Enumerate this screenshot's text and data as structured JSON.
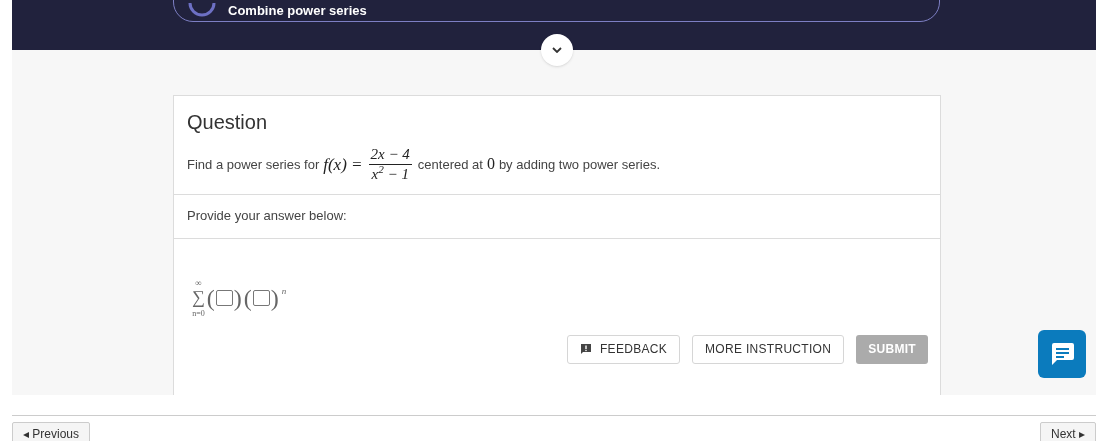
{
  "step_banner": {
    "title": "Combine power series"
  },
  "question": {
    "heading": "Question",
    "prompt": {
      "before": "Find a power series for",
      "function": "f(x) =",
      "numerator": "2x − 4",
      "denominator": "x$^{2}$ − 1",
      "middle": "centered at",
      "center": "0",
      "after": "by adding two power series."
    },
    "answer_label": "Provide your answer below:"
  },
  "answer": {
    "sum_symbol": "∑",
    "upper": "∞",
    "lower": "n=0",
    "open": "(",
    "close": ")",
    "exponent": "n",
    "blanks": [
      {
        "kind": "box"
      },
      {
        "kind": "box"
      }
    ]
  },
  "buttons": [
    {
      "kind": "feedback",
      "label": "FEEDBACK",
      "disabled": false
    },
    {
      "kind": "plain",
      "label": "MORE INSTRUCTION",
      "disabled": false
    },
    {
      "kind": "primary",
      "label": "SUBMIT",
      "disabled": true
    }
  ],
  "nav": {
    "previous": "◂ Previous",
    "next": "Next ▸"
  }
}
